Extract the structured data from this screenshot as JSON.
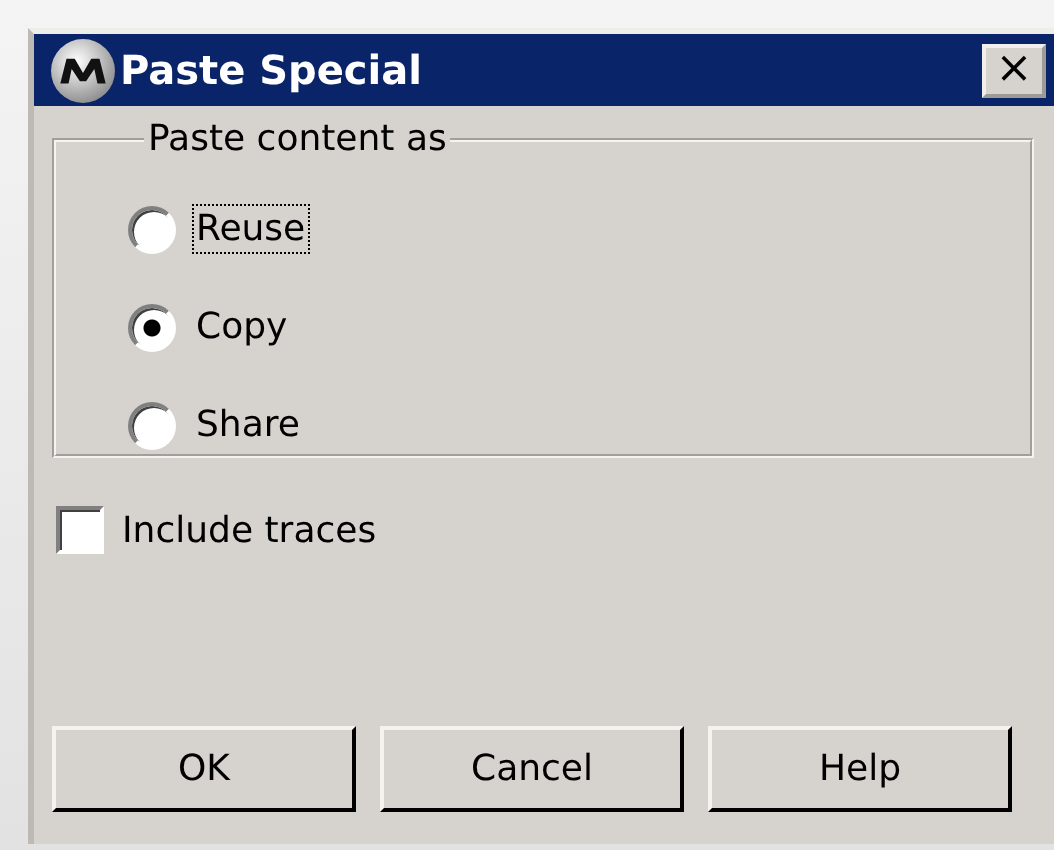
{
  "window": {
    "title": "Paste Special",
    "close": "×"
  },
  "group": {
    "legend": "Paste content as",
    "options": [
      {
        "label": "Reuse",
        "selected": false,
        "focused": true
      },
      {
        "label": "Copy",
        "selected": true,
        "focused": false
      },
      {
        "label": "Share",
        "selected": false,
        "focused": false
      }
    ]
  },
  "checkbox": {
    "label": "Include traces",
    "checked": false
  },
  "buttons": [
    "OK",
    "Cancel",
    "Help"
  ]
}
